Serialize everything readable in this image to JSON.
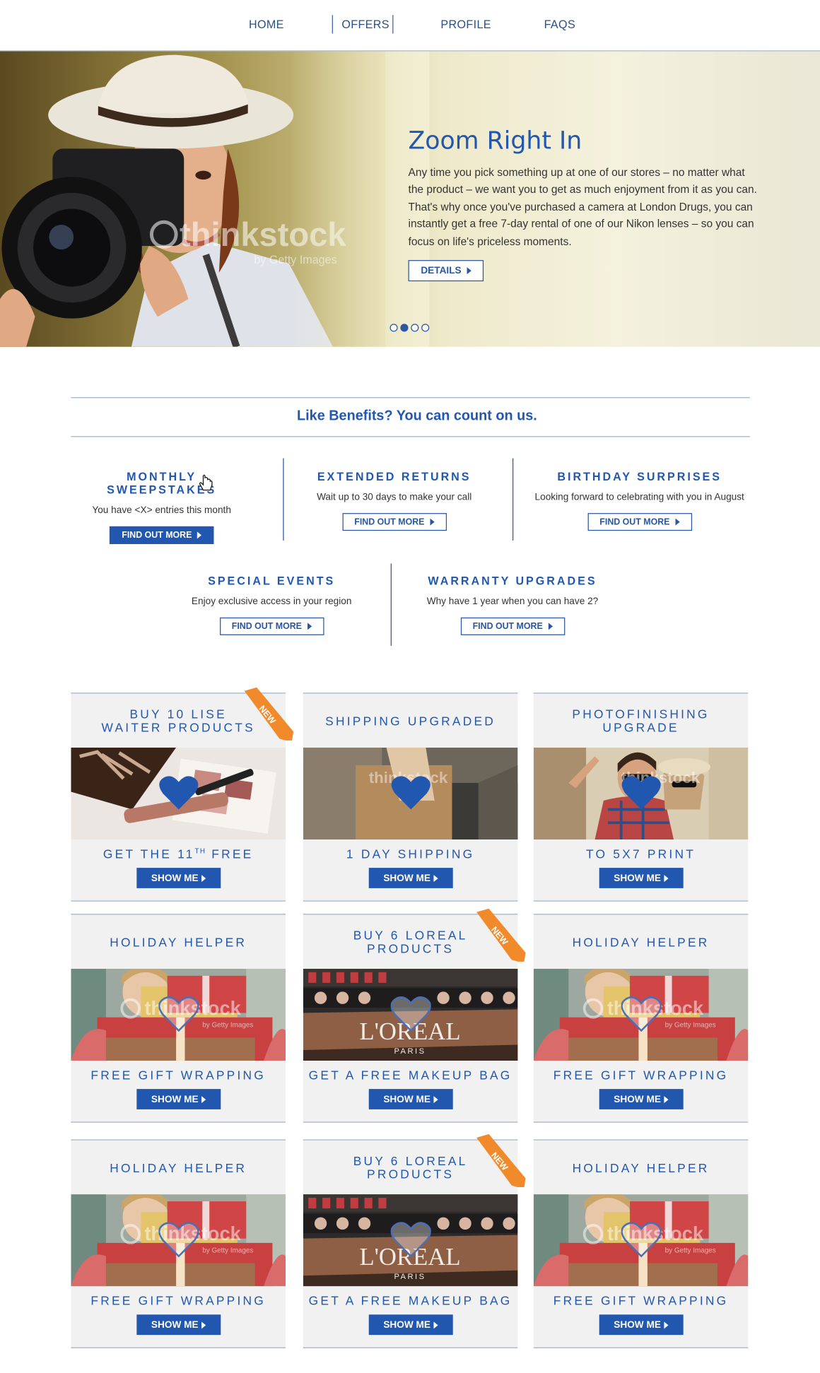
{
  "nav": {
    "items": [
      "HOME",
      "OFFERS",
      "PROFILE",
      "FAQS"
    ]
  },
  "hero": {
    "title": "Zoom Right In",
    "body": "Any time you pick something up at one of our stores – no matter what the product – we want you to get as much enjoyment from it as you can. That's why once you've purchased a camera at London Drugs, you can instantly get a free 7-day rental of one of our Nikon lenses – so you can focus on life's priceless moments.",
    "button_label": "DETAILS",
    "watermark": "thinkstock",
    "watermark_sub": "by Getty Images",
    "slides": 4,
    "active_slide": 2
  },
  "benefits": {
    "heading": "Like Benefits? You can count on us.",
    "items": [
      {
        "title": "MONTHLY SWEEPSTAKES",
        "desc": "You have <X> entries this month",
        "button": "FIND OUT MORE"
      },
      {
        "title": "EXTENDED RETURNS",
        "desc": "Wait up to 30 days to make your call",
        "button": "FIND OUT MORE"
      },
      {
        "title": "BIRTHDAY SURPRISES",
        "desc": "Looking forward to celebrating with you in August",
        "button": "FIND OUT MORE"
      },
      {
        "title": "SPECIAL EVENTS",
        "desc": "Enjoy exclusive access in your region",
        "button": "FIND OUT MORE"
      },
      {
        "title": "WARRANTY UPGRADES",
        "desc": "Why have 1 year when you can have 2?",
        "button": "FIND OUT MORE"
      }
    ]
  },
  "promos": {
    "button_label": "SHOW ME",
    "ribbon_label": "NEW",
    "cards": [
      {
        "title1": "BUY 10 LISE",
        "title2": "WAITER PRODUCTS",
        "sub": "GET THE 11",
        "sub_sup": "TH",
        "sub_end": " FREE",
        "new": true,
        "heart": "filled",
        "image": "makeup"
      },
      {
        "title1": "SHIPPING UPGRADED",
        "title2": "",
        "sub": "1 DAY SHIPPING",
        "sub_sup": "",
        "sub_end": "",
        "new": false,
        "heart": "filled",
        "image": "shipping"
      },
      {
        "title1": "PHOTOFINISHING",
        "title2": "UPGRADE",
        "sub": "TO 5X7 PRINT",
        "sub_sup": "",
        "sub_end": "",
        "new": false,
        "heart": "filled",
        "image": "couple"
      },
      {
        "title1": "HOLIDAY HELPER",
        "title2": "",
        "sub": "FREE GIFT WRAPPING",
        "sub_sup": "",
        "sub_end": "",
        "new": false,
        "heart": "outline",
        "image": "gifts"
      },
      {
        "title1": "BUY 6 LOREAL",
        "title2": "PRODUCTS",
        "sub": "GET A FREE MAKEUP BAG",
        "sub_sup": "",
        "sub_end": "",
        "new": true,
        "heart": "outline",
        "image": "loreal"
      },
      {
        "title1": "HOLIDAY HELPER",
        "title2": "",
        "sub": "FREE GIFT WRAPPING",
        "sub_sup": "",
        "sub_end": "",
        "new": false,
        "heart": "outline",
        "image": "gifts"
      },
      {
        "title1": "HOLIDAY HELPER",
        "title2": "",
        "sub": "FREE GIFT WRAPPING",
        "sub_sup": "",
        "sub_end": "",
        "new": false,
        "heart": "outline",
        "image": "gifts"
      },
      {
        "title1": "BUY 6 LOREAL",
        "title2": "PRODUCTS",
        "sub": "GET A FREE MAKEUP BAG",
        "sub_sup": "",
        "sub_end": "",
        "new": true,
        "heart": "outline",
        "image": "loreal"
      },
      {
        "title1": "HOLIDAY HELPER",
        "title2": "",
        "sub": "FREE GIFT WRAPPING",
        "sub_sup": "",
        "sub_end": "",
        "new": false,
        "heart": "outline",
        "image": "gifts"
      }
    ],
    "loreal_brand": "L'OREAL",
    "loreal_sub": "PARIS"
  },
  "colors": {
    "brand_blue": "#2257b0",
    "ribbon_orange": "#f08a2a",
    "card_bg": "#f1f1f1"
  }
}
